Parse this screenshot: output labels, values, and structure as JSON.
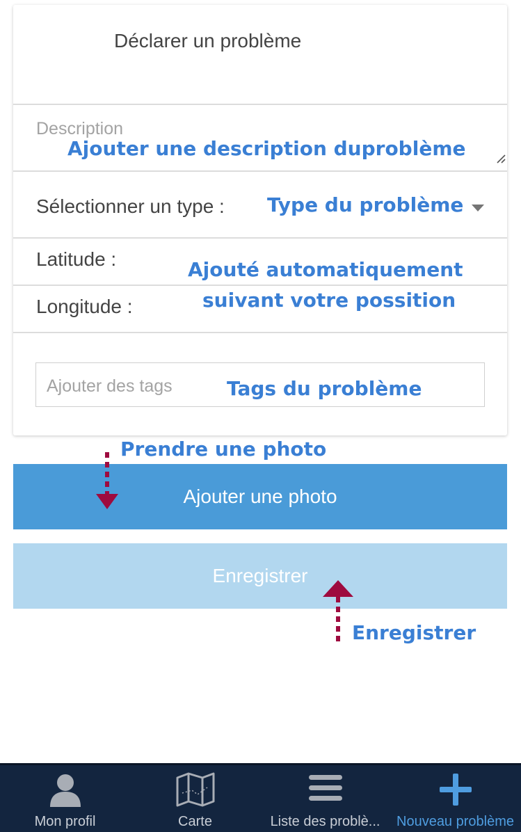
{
  "form": {
    "title": "Déclarer un problème",
    "description_placeholder": "Description",
    "type_label": "Sélectionner un type :",
    "latitude_label": "Latitude :",
    "longitude_label": "Longitude :",
    "tags_placeholder": "Ajouter des tags"
  },
  "annotations": {
    "description": "Ajouter une description duproblème",
    "type": "Type du problème",
    "position_line1": "Ajouté automatiquement",
    "position_line2": "suivant votre possition",
    "tags": "Tags du problème",
    "photo": "Prendre une photo",
    "save": "Enregistrer"
  },
  "buttons": {
    "add_photo": "Ajouter une photo",
    "save": "Enregistrer"
  },
  "tabbar": {
    "items": [
      {
        "label": "Mon profil",
        "icon": "user-icon"
      },
      {
        "label": "Carte",
        "icon": "map-icon"
      },
      {
        "label": "Liste des problè...",
        "icon": "list-icon"
      },
      {
        "label": "Nouveau problème",
        "icon": "plus-icon",
        "active": true
      }
    ]
  },
  "colors": {
    "annotation": "#3a7fd4",
    "arrow": "#9e0b3f",
    "primary_button": "#4a9bd8",
    "disabled_button": "#b2d7ef",
    "tabbar": "#13253f",
    "tab_active": "#4f9de0"
  }
}
